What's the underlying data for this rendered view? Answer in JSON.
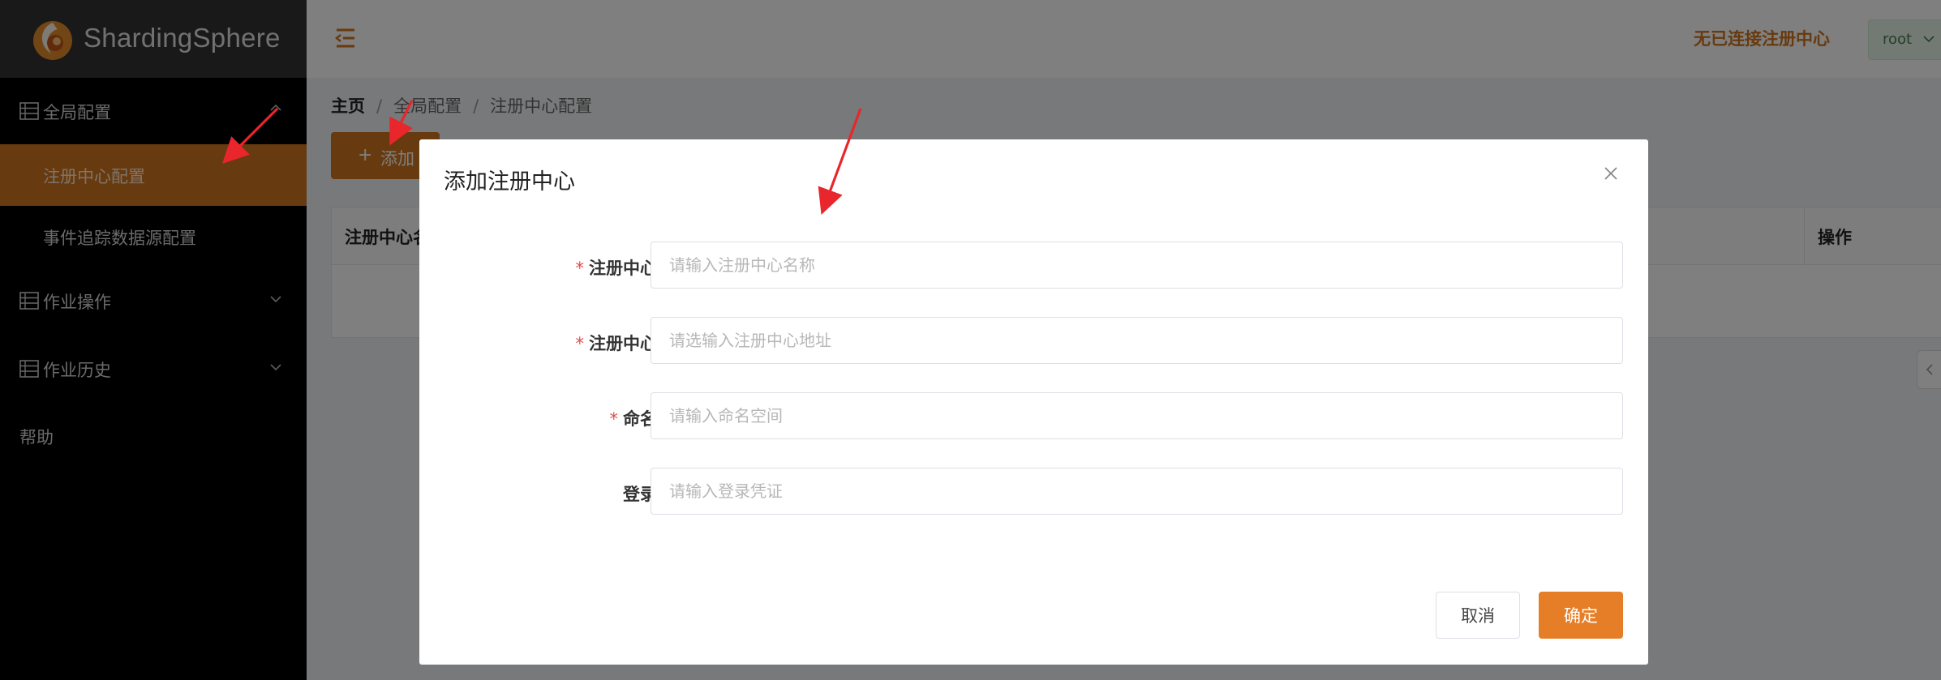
{
  "colors": {
    "accent": "#d0741f",
    "confirm": "#e57e26",
    "required": "#e24b4b",
    "annotation_arrow": "#e8262b"
  },
  "brand": {
    "logo_text": "ShardingSphere",
    "logo_icon": "shardingsphere-logo-icon"
  },
  "sidebar": {
    "items": [
      {
        "label": "全局配置",
        "icon": "table-icon",
        "expanded": true
      },
      {
        "label": "注册中心配置",
        "active": true
      },
      {
        "label": "事件追踪数据源配置"
      },
      {
        "label": "作业操作",
        "icon": "table-icon",
        "expanded": false
      },
      {
        "label": "作业历史",
        "icon": "table-icon",
        "expanded": false
      },
      {
        "label": "帮助"
      }
    ]
  },
  "header": {
    "collapse_icon": "menu-collapse-icon",
    "registry_status": "无已连接注册中心",
    "user": "root"
  },
  "breadcrumb": [
    "主页",
    "全局配置",
    "注册中心配置"
  ],
  "toolbar": {
    "add_label": "添加"
  },
  "table": {
    "columns": [
      "注册中心名称",
      "操作"
    ]
  },
  "dialog": {
    "title": "添加注册中心",
    "fields": [
      {
        "label": "注册中心名称",
        "placeholder": "请输入注册中心名称",
        "required": true,
        "value": ""
      },
      {
        "label": "注册中心地址",
        "placeholder": "请选输入注册中心地址",
        "required": true,
        "value": ""
      },
      {
        "label": "命名空间",
        "placeholder": "请输入命名空间",
        "required": true,
        "value": ""
      },
      {
        "label": "登录凭证",
        "placeholder": "请输入登录凭证",
        "required": false,
        "value": ""
      }
    ],
    "cancel_label": "取消",
    "confirm_label": "确定"
  },
  "required_mark": "*"
}
